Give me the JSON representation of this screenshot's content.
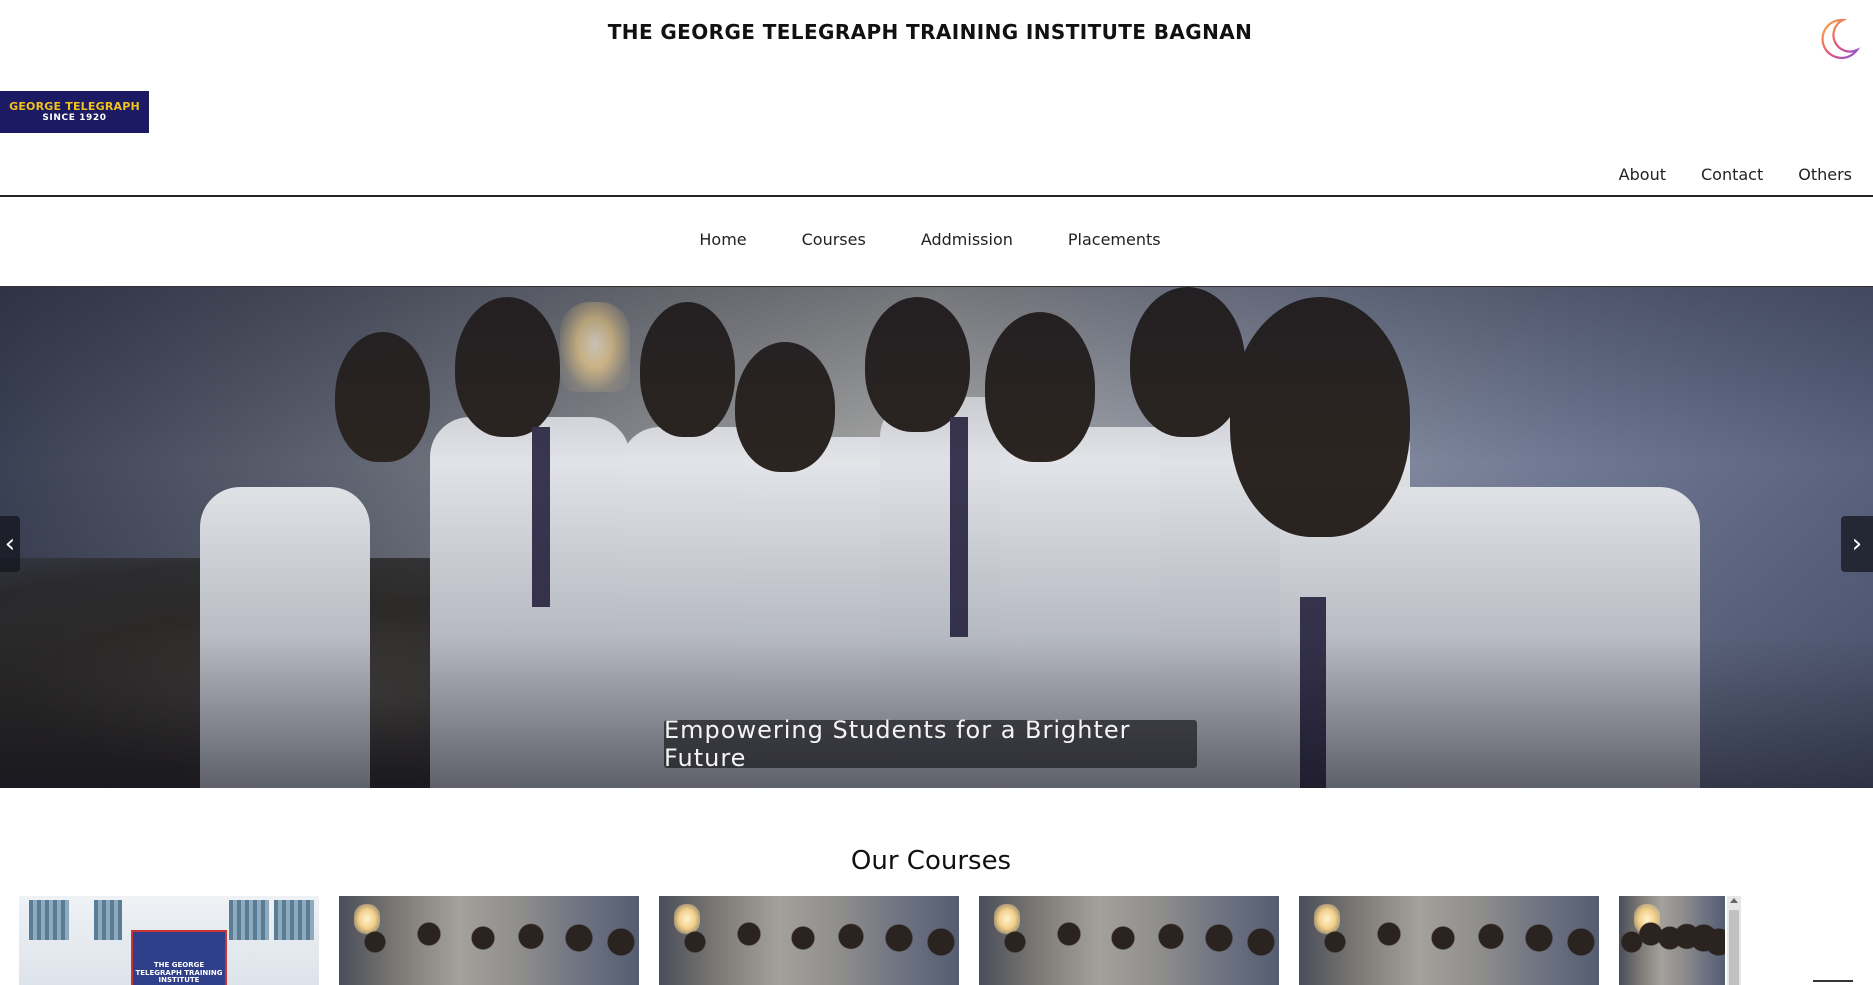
{
  "header": {
    "title": "THE GEORGE TELEGRAPH TRAINING INSTITUTE BAGNAN",
    "theme_toggle_icon": "crescent-moon-icon"
  },
  "logo": {
    "line1": "GEORGE TELEGRAPH",
    "line2": "SINCE 1920",
    "colors": {
      "background": "#1b1a63",
      "line1": "#f1c21b",
      "line2": "#ffffff"
    }
  },
  "top_links": [
    {
      "label": "About"
    },
    {
      "label": "Contact"
    },
    {
      "label": "Others"
    }
  ],
  "main_nav": [
    {
      "label": "Home"
    },
    {
      "label": "Courses"
    },
    {
      "label": "Addmission"
    },
    {
      "label": "Placements"
    }
  ],
  "hero": {
    "caption": "Empowering Students for a Brighter Future",
    "prev_icon": "chevron-left-icon",
    "next_icon": "chevron-right-icon",
    "prev_symbol": "‹",
    "next_symbol": "›"
  },
  "courses": {
    "heading": "Our Courses",
    "cards": [
      {
        "type": "building-photo",
        "sign_text": "THE GEORGE TELEGRAPH TRAINING INSTITUTE"
      },
      {
        "type": "students-photo"
      },
      {
        "type": "students-photo"
      },
      {
        "type": "students-photo"
      },
      {
        "type": "students-photo"
      },
      {
        "type": "students-photo"
      }
    ]
  }
}
